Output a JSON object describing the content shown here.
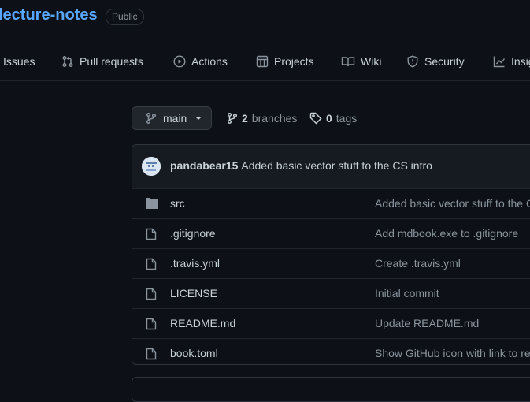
{
  "repo": {
    "name": "lecture-notes",
    "visibility": "Public"
  },
  "tabs": [
    {
      "label": "Issues",
      "icon": "issue-icon"
    },
    {
      "label": "Pull requests",
      "icon": "pull-request-icon"
    },
    {
      "label": "Actions",
      "icon": "play-icon"
    },
    {
      "label": "Projects",
      "icon": "table-icon"
    },
    {
      "label": "Wiki",
      "icon": "book-icon"
    },
    {
      "label": "Security",
      "icon": "shield-icon"
    },
    {
      "label": "Insights",
      "icon": "graph-icon"
    }
  ],
  "branch": {
    "current": "main"
  },
  "branches": {
    "count": "2",
    "label": "branches"
  },
  "tags": {
    "count": "0",
    "label": "tags"
  },
  "commit": {
    "author": "pandabear15",
    "message": "Added basic vector stuff to the CS intro"
  },
  "files": [
    {
      "type": "dir",
      "name": "src",
      "message": "Added basic vector stuff to the CS intro"
    },
    {
      "type": "file",
      "name": ".gitignore",
      "message": "Add mdbook.exe to .gitignore"
    },
    {
      "type": "file",
      "name": ".travis.yml",
      "message": "Create .travis.yml"
    },
    {
      "type": "file",
      "name": "LICENSE",
      "message": "Initial commit"
    },
    {
      "type": "file",
      "name": "README.md",
      "message": "Update README.md"
    },
    {
      "type": "file",
      "name": "book.toml",
      "message": "Show GitHub icon with link to repo"
    }
  ]
}
